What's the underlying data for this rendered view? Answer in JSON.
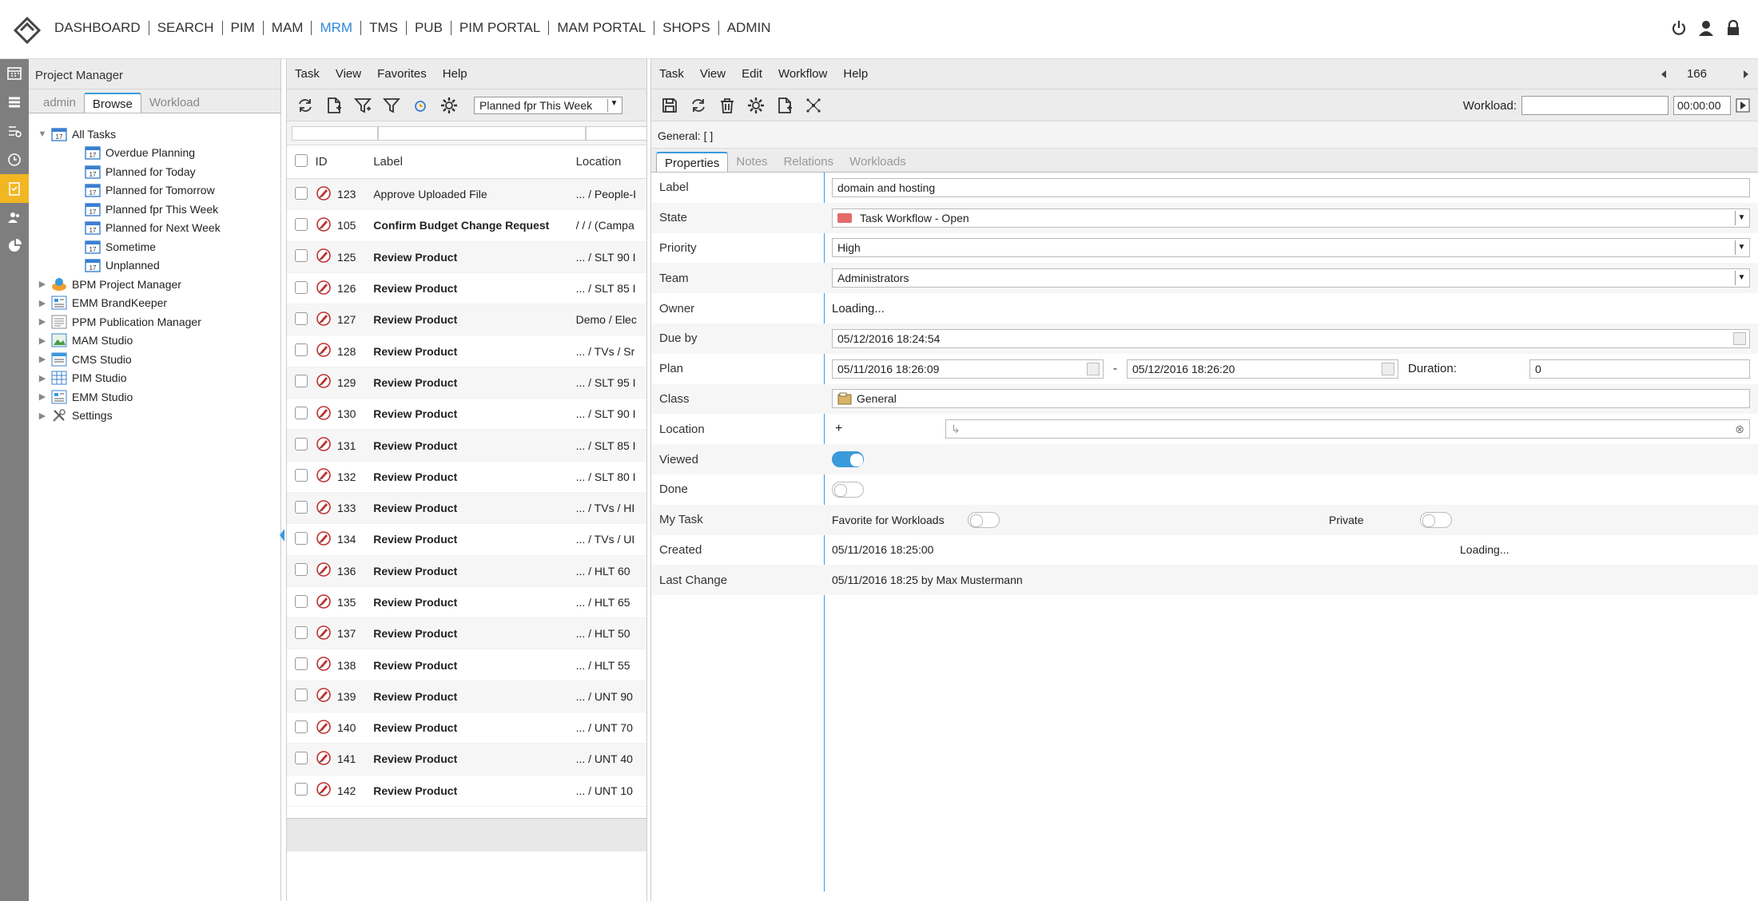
{
  "nav": {
    "items": [
      "DASHBOARD",
      "SEARCH",
      "PIM",
      "MAM",
      "MRM",
      "TMS",
      "PUB",
      "PIM PORTAL",
      "MAM PORTAL",
      "SHOPS",
      "ADMIN"
    ],
    "active": "MRM",
    "right_icons": [
      "power-icon",
      "user-icon",
      "lock-icon"
    ]
  },
  "rail": {
    "icons": [
      "calendar-icon",
      "list-icon",
      "timeline-icon",
      "clock-icon",
      "task-icon",
      "people-icon",
      "pie-chart-icon"
    ],
    "active_index": 4
  },
  "project_manager": {
    "title": "Project Manager",
    "tabs": [
      "admin",
      "Browse",
      "Workload"
    ],
    "active_tab": "Browse",
    "tree": [
      {
        "label": "All Tasks",
        "level": 0,
        "expanded": true,
        "icon": "calendar-icon"
      },
      {
        "label": "Overdue Planning",
        "level": 1,
        "icon": "calendar-icon"
      },
      {
        "label": "Planned for Today",
        "level": 1,
        "icon": "calendar-icon"
      },
      {
        "label": "Planned for Tomorrow",
        "level": 1,
        "icon": "calendar-icon"
      },
      {
        "label": "Planned fpr This Week",
        "level": 1,
        "icon": "calendar-icon"
      },
      {
        "label": "Planned for Next Week",
        "level": 1,
        "icon": "calendar-icon"
      },
      {
        "label": "Sometime",
        "level": 1,
        "icon": "calendar-icon"
      },
      {
        "label": "Unplanned",
        "level": 1,
        "icon": "calendar-icon"
      },
      {
        "label": "BPM Project Manager",
        "level": 0,
        "expanded": false,
        "icon": "bpm-icon"
      },
      {
        "label": "EMM BrandKeeper",
        "level": 0,
        "expanded": false,
        "icon": "brandkeeper-icon"
      },
      {
        "label": "PPM Publication Manager",
        "level": 0,
        "expanded": false,
        "icon": "publication-icon"
      },
      {
        "label": "MAM Studio",
        "level": 0,
        "expanded": false,
        "icon": "mam-icon"
      },
      {
        "label": "CMS Studio",
        "level": 0,
        "expanded": false,
        "icon": "cms-icon"
      },
      {
        "label": "PIM Studio",
        "level": 0,
        "expanded": false,
        "icon": "pim-icon"
      },
      {
        "label": "EMM Studio",
        "level": 0,
        "expanded": false,
        "icon": "emm-icon"
      },
      {
        "label": "Settings",
        "level": 0,
        "expanded": false,
        "icon": "tools-icon"
      }
    ]
  },
  "task_list": {
    "menu": [
      "Task",
      "View",
      "Favorites",
      "Help"
    ],
    "toolbar_icons": [
      "refresh-icon",
      "new-task-icon",
      "filter-add-icon",
      "filter-icon",
      "clock-icon",
      "gear-icon"
    ],
    "filter_select": "Planned fpr This Week",
    "columns": [
      "ID",
      "Label",
      "Location"
    ],
    "rows": [
      {
        "id": "123",
        "label": "Approve Uploaded File",
        "location": "... / People-I",
        "bold": false
      },
      {
        "id": "105",
        "label": "Confirm Budget Change Request",
        "location": "/ / / (Campa",
        "bold": true
      },
      {
        "id": "125",
        "label": "Review Product",
        "location": "... / SLT 90 I",
        "bold": true
      },
      {
        "id": "126",
        "label": "Review Product",
        "location": "... / SLT 85 I",
        "bold": true
      },
      {
        "id": "127",
        "label": "Review Product",
        "location": "Demo / Elec",
        "bold": true
      },
      {
        "id": "128",
        "label": "Review Product",
        "location": "... / TVs / Sr",
        "bold": true
      },
      {
        "id": "129",
        "label": "Review Product",
        "location": "... / SLT 95 I",
        "bold": true
      },
      {
        "id": "130",
        "label": "Review Product",
        "location": "... / SLT 90 I",
        "bold": true
      },
      {
        "id": "131",
        "label": "Review Product",
        "location": "... / SLT 85 I",
        "bold": true
      },
      {
        "id": "132",
        "label": "Review Product",
        "location": "... / SLT 80 I",
        "bold": true
      },
      {
        "id": "133",
        "label": "Review Product",
        "location": "... / TVs / HI",
        "bold": true
      },
      {
        "id": "134",
        "label": "Review Product",
        "location": "... / TVs / UI",
        "bold": true
      },
      {
        "id": "136",
        "label": "Review Product",
        "location": "... / HLT 60",
        "bold": true
      },
      {
        "id": "135",
        "label": "Review Product",
        "location": "... / HLT 65",
        "bold": true
      },
      {
        "id": "137",
        "label": "Review Product",
        "location": "... / HLT 50",
        "bold": true
      },
      {
        "id": "138",
        "label": "Review Product",
        "location": "... / HLT 55",
        "bold": true
      },
      {
        "id": "139",
        "label": "Review Product",
        "location": "... / UNT 90",
        "bold": true
      },
      {
        "id": "140",
        "label": "Review Product",
        "location": "... / UNT 70",
        "bold": true
      },
      {
        "id": "141",
        "label": "Review Product",
        "location": "... / UNT 40",
        "bold": true
      },
      {
        "id": "142",
        "label": "Review Product",
        "location": "... / UNT 10",
        "bold": true
      }
    ]
  },
  "detail": {
    "menu": [
      "Task",
      "View",
      "Edit",
      "Workflow",
      "Help"
    ],
    "pager": {
      "count": "166"
    },
    "toolbar_icons": [
      "save-icon",
      "refresh-icon",
      "delete-icon",
      "gear-icon",
      "new-task-icon",
      "workflow-icon"
    ],
    "workload_label": "Workload:",
    "workload_value": "",
    "workload_time": "00:00:00",
    "general": "General: [  ]",
    "tabs": [
      "Properties",
      "Notes",
      "Relations",
      "Workloads"
    ],
    "active_tab": "Properties",
    "props": {
      "label": {
        "name": "Label",
        "value": "domain and hosting"
      },
      "state": {
        "name": "State",
        "value": "Task Workflow - Open",
        "color": "#e46a6a"
      },
      "priority": {
        "name": "Priority",
        "value": "High"
      },
      "team": {
        "name": "Team",
        "value": "Administrators"
      },
      "owner": {
        "name": "Owner",
        "value": "Loading..."
      },
      "due_by": {
        "name": "Due by",
        "value": "05/12/2016 18:24:54"
      },
      "plan": {
        "name": "Plan",
        "start": "05/11/2016 18:26:09",
        "sep": "-",
        "end": "05/12/2016 18:26:20",
        "duration_label": "Duration:",
        "duration": "0"
      },
      "class": {
        "name": "Class",
        "value": "General"
      },
      "location": {
        "name": "Location",
        "add": "+",
        "value": ""
      },
      "viewed": {
        "name": "Viewed",
        "on": true
      },
      "done": {
        "name": "Done",
        "on": false
      },
      "my_task": {
        "name": "My Task",
        "favorite_label": "Favorite for Workloads",
        "favorite_on": false,
        "private_label": "Private",
        "private_on": false
      },
      "created": {
        "name": "Created",
        "value": "05/11/2016 18:25:00",
        "extra": "Loading..."
      },
      "last_change": {
        "name": "Last Change",
        "value": "05/11/2016 18:25 by Max Mustermann"
      }
    }
  }
}
